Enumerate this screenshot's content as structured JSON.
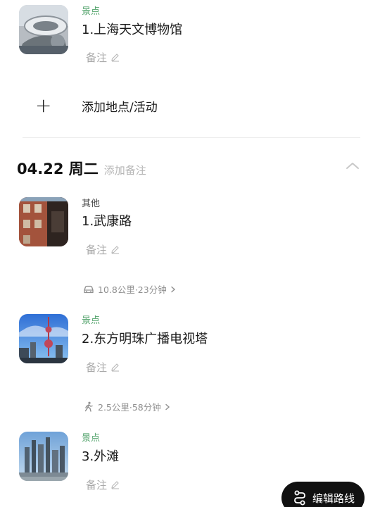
{
  "items": [
    {
      "category": "景点",
      "title": "1.上海天文博物馆",
      "note_placeholder": "备注"
    },
    {
      "category": "其他",
      "title": "1.武康路",
      "note_placeholder": "备注"
    },
    {
      "category": "景点",
      "title": "2.东方明珠广播电视塔",
      "note_placeholder": "备注"
    },
    {
      "category": "景点",
      "title": "3.外滩",
      "note_placeholder": "备注"
    }
  ],
  "add_place": {
    "label": "添加地点/活动",
    "icon": "plus-icon"
  },
  "day": {
    "date": "04.22 周二",
    "add_note": "添加备注",
    "collapse_icon": "chevron-up-icon"
  },
  "routes": [
    {
      "mode": "car",
      "icon": "car-icon",
      "text": "10.8公里·23分钟"
    },
    {
      "mode": "walk",
      "icon": "walk-icon",
      "text": "2.5公里·58分钟"
    }
  ],
  "fab": {
    "label": "编辑路线",
    "icon": "route-icon"
  },
  "colors": {
    "category_green": "#52a36b",
    "text_primary": "#1a1a1a",
    "muted": "#a9a9a9",
    "fab_bg": "#111111"
  }
}
